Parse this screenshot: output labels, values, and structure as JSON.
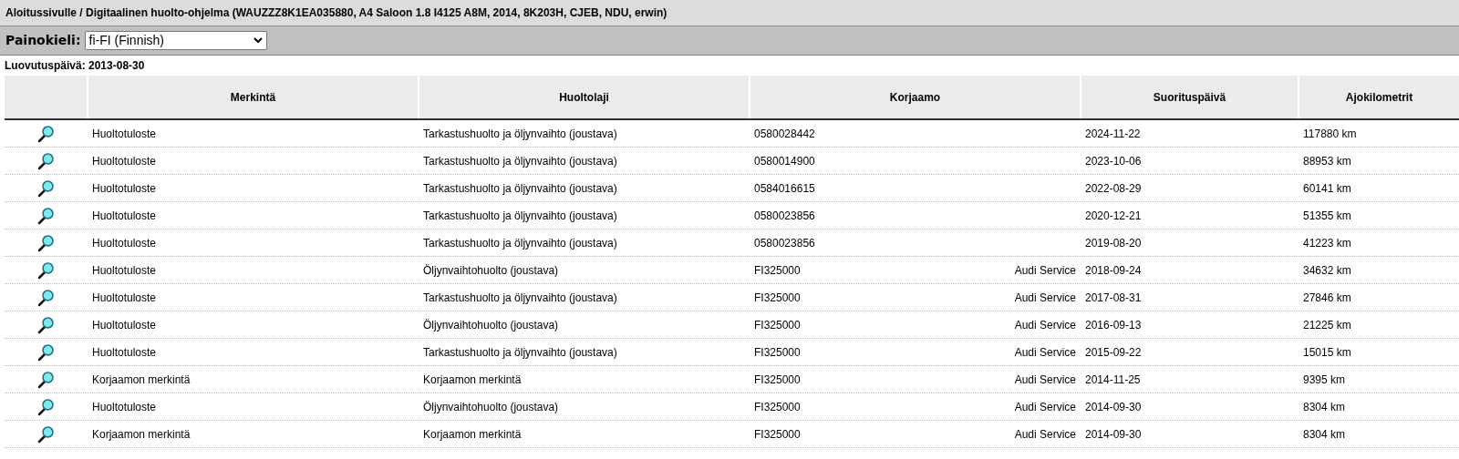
{
  "title_bar": {
    "breadcrumb": "Aloitussivulle / Digitaalinen huolto-ohjelma (WAUZZZ8K1EA035880, A4 Saloon 1.8 I4125 A8M, 2014, 8K203H, CJEB, NDU, erwin)"
  },
  "language_bar": {
    "label": "Painokieli:",
    "value": "fi-FI (Finnish)"
  },
  "delivery_date": "Luovutuspäivä: 2013-08-30",
  "table": {
    "columns": [
      "Merkintä",
      "Huoltolaji",
      "Korjaamo",
      "Suorituspäivä",
      "Ajokilometrit"
    ],
    "rows": [
      {
        "entry": "Huoltotuloste",
        "service": "Tarkastushuolto ja öljynvaihto (joustava)",
        "workshop_code": "0580028442",
        "date": "2024-11-22",
        "mileage": "117880 km"
      },
      {
        "entry": "Huoltotuloste",
        "service": "Tarkastushuolto ja öljynvaihto (joustava)",
        "workshop_code": "0580014900",
        "date": "2023-10-06",
        "mileage": "88953 km"
      },
      {
        "entry": "Huoltotuloste",
        "service": "Tarkastushuolto ja öljynvaihto (joustava)",
        "workshop_code": "0584016615",
        "date": "2022-08-29",
        "mileage": "60141 km"
      },
      {
        "entry": "Huoltotuloste",
        "service": "Tarkastushuolto ja öljynvaihto (joustava)",
        "workshop_code": "0580023856",
        "date": "2020-12-21",
        "mileage": "51355 km"
      },
      {
        "entry": "Huoltotuloste",
        "service": "Tarkastushuolto ja öljynvaihto (joustava)",
        "workshop_code": "0580023856",
        "date": "2019-08-20",
        "mileage": "41223 km"
      },
      {
        "entry": "Huoltotuloste",
        "service": "Öljynvaihtohuolto (joustava)",
        "workshop_code": "FI325000",
        "workshop_name": "Audi Service",
        "date": "2018-09-24",
        "mileage": "34632 km"
      },
      {
        "entry": "Huoltotuloste",
        "service": "Tarkastushuolto ja öljynvaihto (joustava)",
        "workshop_code": "FI325000",
        "workshop_name": "Audi Service",
        "date": "2017-08-31",
        "mileage": "27846 km"
      },
      {
        "entry": "Huoltotuloste",
        "service": "Öljynvaihtohuolto (joustava)",
        "workshop_code": "FI325000",
        "workshop_name": "Audi Service",
        "date": "2016-09-13",
        "mileage": "21225 km"
      },
      {
        "entry": "Huoltotuloste",
        "service": "Tarkastushuolto ja öljynvaihto (joustava)",
        "workshop_code": "FI325000",
        "workshop_name": "Audi Service",
        "date": "2015-09-22",
        "mileage": "15015 km"
      },
      {
        "entry": "Korjaamon merkintä",
        "service": "Korjaamon merkintä",
        "workshop_code": "FI325000",
        "workshop_name": "Audi Service",
        "date": "2014-11-25",
        "mileage": "9395 km"
      },
      {
        "entry": "Huoltotuloste",
        "service": "Öljynvaihtohuolto (joustava)",
        "workshop_code": "FI325000",
        "workshop_name": "Audi Service",
        "date": "2014-09-30",
        "mileage": "8304 km"
      },
      {
        "entry": "Korjaamon merkintä",
        "service": "Korjaamon merkintä",
        "workshop_code": "FI325000",
        "workshop_name": "Audi Service",
        "date": "2014-09-30",
        "mileage": "8304 km"
      }
    ]
  }
}
